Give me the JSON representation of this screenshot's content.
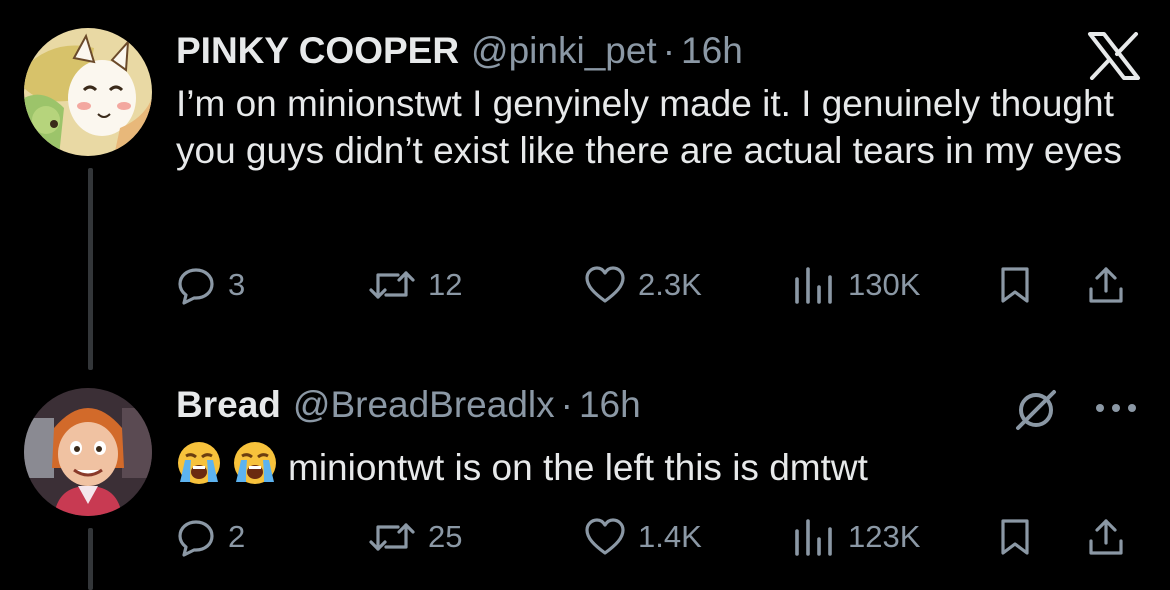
{
  "tweets": [
    {
      "name": "PINKY COOPER",
      "handle": "@pinki_pet",
      "separator": "·",
      "time": "16h",
      "text": "I’m on minionstwt I genyinely made it. I genuinely thought you guys didn’t exist like there are actual tears in my eyes",
      "replies": "3",
      "retweets": "12",
      "likes": "2.3K",
      "views": "130K"
    },
    {
      "name": "Bread",
      "handle": "@BreadBreadlx",
      "separator": "·",
      "time": "16h",
      "text": "miniontwt is on the left this is dmtwt",
      "replies": "2",
      "retweets": "25",
      "likes": "1.4K",
      "views": "123K"
    }
  ],
  "icons": {
    "header_right_1": "x-logo-icon",
    "header_right_2": "grok-icon",
    "more": "more-icon",
    "emoji": "loudly-crying-face-icon"
  },
  "colors": {
    "background": "#000000",
    "text": "#e7e9ea",
    "muted": "#8b98a5",
    "thread_line": "#333639"
  }
}
